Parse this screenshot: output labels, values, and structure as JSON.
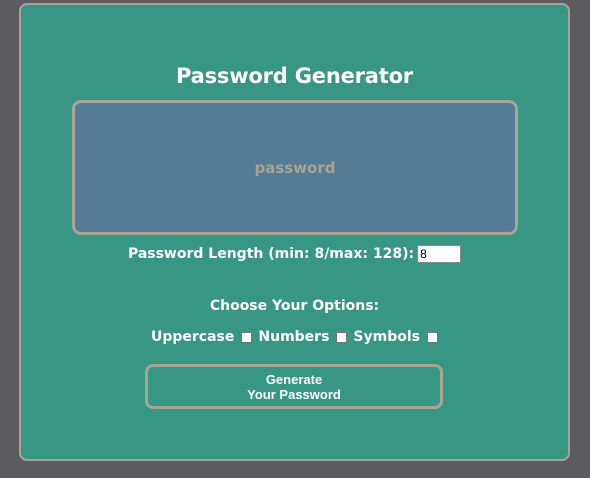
{
  "card": {
    "title": "Password Generator",
    "password_placeholder": "password",
    "length_label": "Password Length (min: 8/max: 128):",
    "length_value": "8",
    "options_title": "Choose Your Options:",
    "options": [
      {
        "label": "Uppercase",
        "checked": false
      },
      {
        "label": "Numbers",
        "checked": false
      },
      {
        "label": "Symbols",
        "checked": false
      }
    ],
    "generate_button": {
      "line1": "Generate",
      "line2": "Your Password"
    }
  },
  "colors": {
    "page_background": "#5c5b60",
    "card_background": "#379782",
    "border": "#a7a595",
    "password_box_background": "#557b95",
    "placeholder_text": "#a9a595"
  }
}
